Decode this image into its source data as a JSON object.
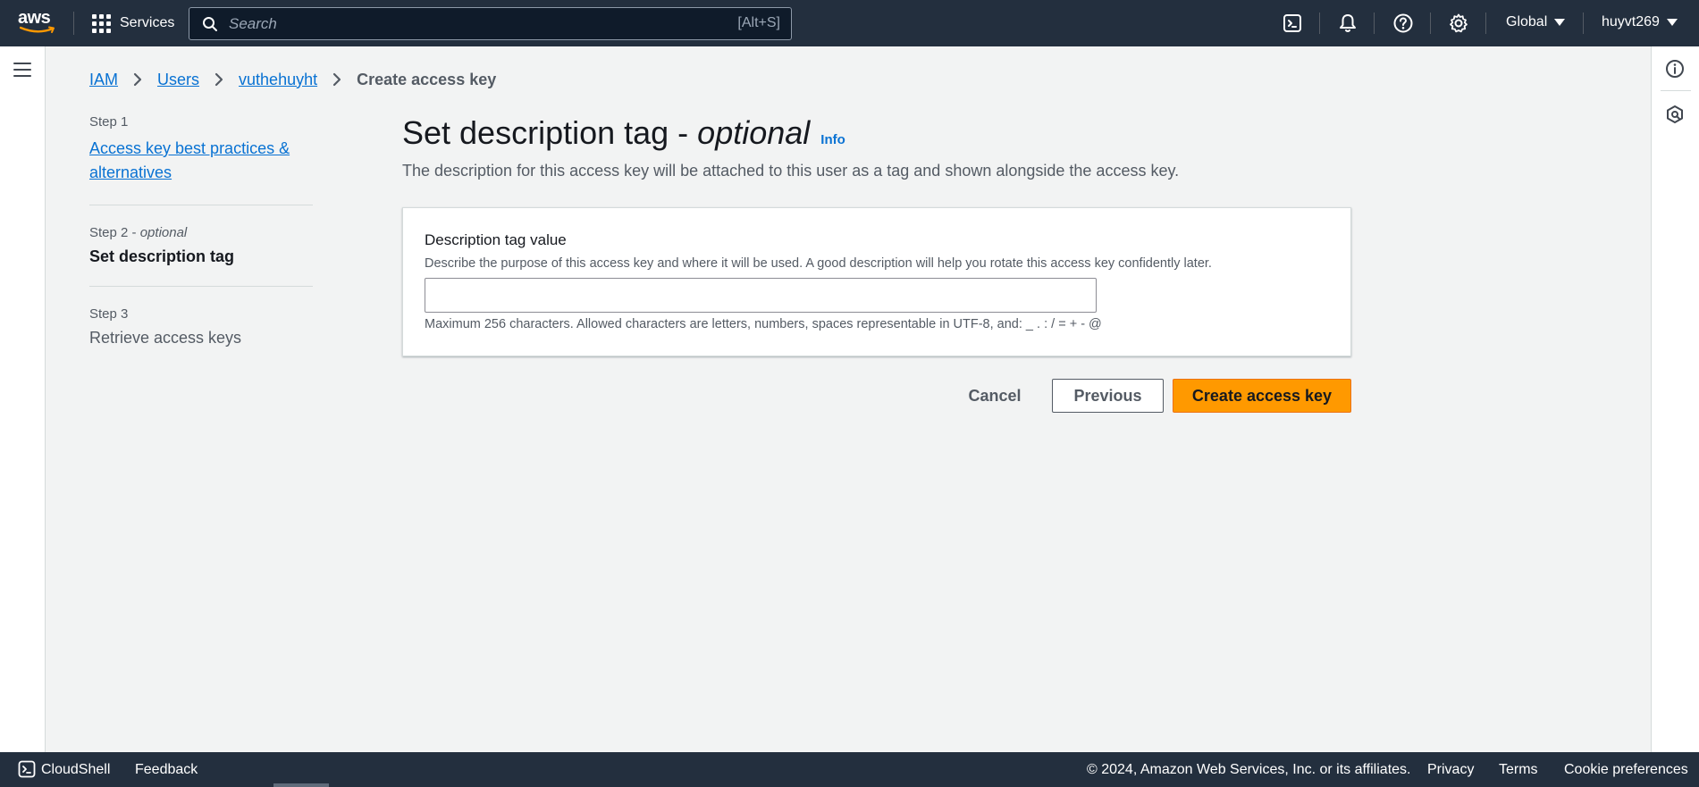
{
  "topnav": {
    "logo_text": "aws",
    "services_label": "Services",
    "search_placeholder": "Search",
    "search_shortcut": "[Alt+S]",
    "region_label": "Global",
    "user_label": "huyvt269",
    "icons": [
      "cloudshell-icon",
      "bell-icon",
      "help-icon",
      "settings-icon"
    ]
  },
  "breadcrumb": {
    "items": [
      "IAM",
      "Users",
      "vuthehuyht"
    ],
    "current": "Create access key"
  },
  "steps": [
    {
      "number": "Step 1",
      "label": "Access key best practices & alternatives",
      "state": "link"
    },
    {
      "number": "Step 2",
      "optional": "optional",
      "label": "Set description tag",
      "state": "active"
    },
    {
      "number": "Step 3",
      "label": "Retrieve access keys",
      "state": "disabled"
    }
  ],
  "main": {
    "title": "Set description tag - ",
    "title_italic": "optional",
    "info_link": "Info",
    "description": "The description for this access key will be attached to this user as a tag and shown alongside the access key."
  },
  "form": {
    "label": "Description tag value",
    "description": "Describe the purpose of this access key and where it will be used. A good description will help you rotate this access key confidently later.",
    "value": "",
    "constraint": "Maximum 256 characters. Allowed characters are letters, numbers, spaces representable in UTF-8, and: _ . : / = + - @"
  },
  "actions": {
    "cancel": "Cancel",
    "previous": "Previous",
    "create": "Create access key"
  },
  "footer": {
    "cloudshell": "CloudShell",
    "feedback": "Feedback",
    "copyright": "© 2024, Amazon Web Services, Inc. or its affiliates.",
    "privacy": "Privacy",
    "terms": "Terms",
    "cookies": "Cookie preferences"
  },
  "colors": {
    "nav_bg": "#232f3e",
    "primary_button": "#ff9900",
    "link": "#0972d3",
    "page_bg": "#f2f3f3"
  }
}
